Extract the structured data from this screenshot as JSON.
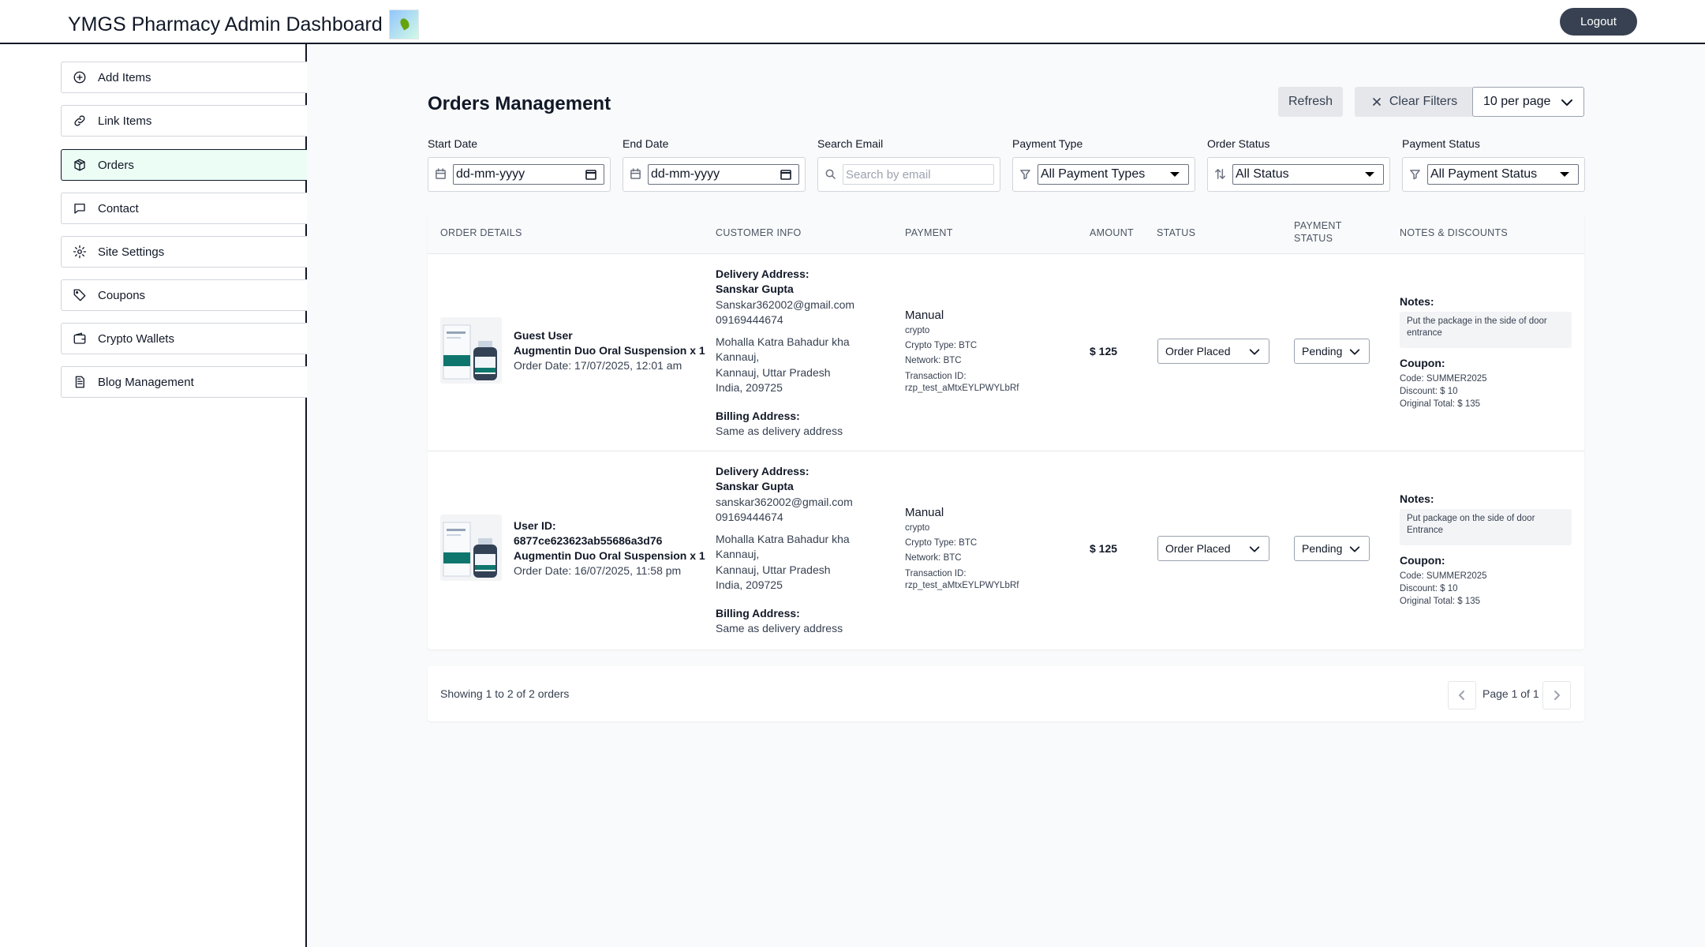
{
  "header": {
    "title": "YMGS Pharmacy Admin Dashboard",
    "logout_label": "Logout"
  },
  "sidebar": {
    "items": [
      {
        "label": "Add Items",
        "icon": "plus-circle-icon"
      },
      {
        "label": "Link Items",
        "icon": "link-icon"
      },
      {
        "label": "Orders",
        "icon": "package-icon",
        "active": true
      },
      {
        "label": "Contact",
        "icon": "message-icon"
      },
      {
        "label": "Site Settings",
        "icon": "gear-icon"
      },
      {
        "label": "Coupons",
        "icon": "tag-icon"
      },
      {
        "label": "Crypto Wallets",
        "icon": "wallet-icon"
      },
      {
        "label": "Blog Management",
        "icon": "document-icon"
      }
    ]
  },
  "main": {
    "title": "Orders Management",
    "refresh_label": "Refresh",
    "clear_filters_label": "Clear Filters",
    "per_page": "10 per page"
  },
  "filters": {
    "start_date": {
      "label": "Start Date",
      "value": "dd-mm-yyyy"
    },
    "end_date": {
      "label": "End Date",
      "value": "dd-mm-yyyy"
    },
    "search_email": {
      "label": "Search Email",
      "placeholder": "Search by email"
    },
    "payment_type": {
      "label": "Payment Type",
      "value": "All Payment Types"
    },
    "order_status": {
      "label": "Order Status",
      "value": "All Status"
    },
    "payment_status": {
      "label": "Payment Status",
      "value": "All Payment Status"
    }
  },
  "table": {
    "columns": [
      "ORDER DETAILS",
      "CUSTOMER INFO",
      "PAYMENT",
      "AMOUNT",
      "STATUS",
      "PAYMENT",
      "STATUS",
      "NOTES & DISCOUNTS"
    ],
    "rows": [
      {
        "user": "Guest User",
        "user_id": "",
        "product": "Augmentin Duo Oral Suspension x 1",
        "order_date": "Order Date: 17/07/2025, 12:01 am",
        "delivery_label": "Delivery Address:",
        "name": "Sanskar Gupta",
        "email": "Sanskar362002@gmail.com",
        "phone": "09169444674",
        "addr1": "Mohalla Katra Bahadur kha",
        "addr2": "Kannauj,",
        "addr3": "Kannauj, Uttar Pradesh",
        "addr4": "India, 209725",
        "billing_label": "Billing Address:",
        "billing": "Same as delivery address",
        "payment_method": "Manual",
        "payment_kind": "crypto",
        "crypto_type": "Crypto Type: BTC",
        "network": "Network: BTC",
        "txn_label": "Transaction ID:",
        "txn_id": "rzp_test_aMtxEYLPWYLbRf",
        "amount": "$ 125",
        "status": "Order Placed",
        "payment_status": "Pending",
        "notes_label": "Notes:",
        "note": "Put the package in the side of door entrance",
        "coupon_label": "Coupon:",
        "coupon_code": "Code: SUMMER2025",
        "discount": "Discount: $ 10",
        "original_total": "Original Total: $ 135"
      },
      {
        "user": "User ID:",
        "user_id": "6877ce623623ab55686a3d76",
        "product": "Augmentin Duo Oral Suspension x 1",
        "order_date": "Order Date: 16/07/2025, 11:58 pm",
        "delivery_label": "Delivery Address:",
        "name": "Sanskar Gupta",
        "email": "sanskar362002@gmail.com",
        "phone": "09169444674",
        "addr1": "Mohalla Katra Bahadur kha",
        "addr2": "Kannauj,",
        "addr3": "Kannauj, Uttar Pradesh",
        "addr4": "India, 209725",
        "billing_label": "Billing Address:",
        "billing": "Same as delivery address",
        "payment_method": "Manual",
        "payment_kind": "crypto",
        "crypto_type": "Crypto Type: BTC",
        "network": "Network: BTC",
        "txn_label": "Transaction ID:",
        "txn_id": "rzp_test_aMtxEYLPWYLbRf",
        "amount": "$ 125",
        "status": "Order Placed",
        "payment_status": "Pending",
        "notes_label": "Notes:",
        "note": "Put package on the side of door Entrance",
        "coupon_label": "Coupon:",
        "coupon_code": "Code: SUMMER2025",
        "discount": "Discount: $ 10",
        "original_total": "Original Total: $ 135"
      }
    ]
  },
  "pagination": {
    "summary": "Showing 1 to 2 of 2 orders",
    "page": "Page 1 of 1"
  }
}
